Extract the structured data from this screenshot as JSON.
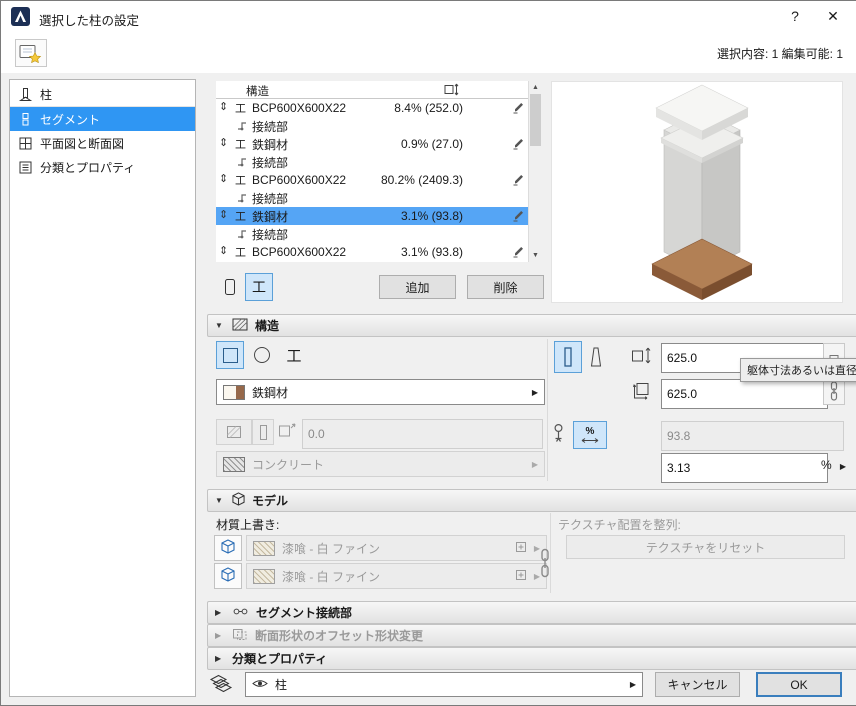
{
  "colors": {
    "selection_blue": "#2f96f3",
    "row_selection": "#55a5f5",
    "toggle_bg": "#cfe6fa",
    "toggle_border": "#5ba0d8",
    "material_brown": "#96684a",
    "base_brown": "#a87a50"
  },
  "icons": {
    "drag_handle": "⇕",
    "i_beam": "工",
    "chevron_right": "▶",
    "collapse_down": "▼",
    "collapse_right": "▶",
    "scroll_up": "▲",
    "scroll_down": "▼"
  },
  "window": {
    "title": "選択した柱の設定",
    "help_label": "?",
    "close_label": "✕",
    "selection_info": "選択内容: 1 編集可能: 1"
  },
  "sidebar": {
    "items": [
      {
        "label": "柱",
        "icon": "column-icon",
        "selected": false
      },
      {
        "label": "セグメント",
        "icon": "segment-icon",
        "selected": true
      },
      {
        "label": "平面図と断面図",
        "icon": "plan-section-icon",
        "selected": false
      },
      {
        "label": "分類とプロパティ",
        "icon": "properties-icon",
        "selected": false
      }
    ]
  },
  "segment_list": {
    "col_structure": "構造",
    "rows": [
      {
        "type": "segment",
        "name": "BCP600X600X22",
        "value": "8.4% (252.0)",
        "selected": false
      },
      {
        "type": "joint",
        "name": "接続部"
      },
      {
        "type": "segment",
        "name": "鉄鋼材",
        "value": "0.9% (27.0)",
        "selected": false
      },
      {
        "type": "joint",
        "name": "接続部"
      },
      {
        "type": "segment",
        "name": "BCP600X600X22",
        "value": "80.2% (2409.3)",
        "selected": false
      },
      {
        "type": "joint",
        "name": "接続部"
      },
      {
        "type": "segment",
        "name": "鉄鋼材",
        "value": "3.1% (93.8)",
        "selected": true
      },
      {
        "type": "joint",
        "name": "接続部"
      },
      {
        "type": "segment",
        "name": "BCP600X600X22",
        "value": "3.1% (93.8)",
        "selected": false
      }
    ],
    "add_label": "追加",
    "delete_label": "削除"
  },
  "structure_panel": {
    "title": "構造",
    "material_name": "鉄鋼材",
    "veneer_value": "0.0",
    "core_material_name": "コンクリート",
    "width_value": "625.0",
    "height_value": "625.0",
    "fixed_value": "93.8",
    "percent_value": "3.13",
    "percent_sign": "%",
    "tooltip": "躯体寸法あるいは直径"
  },
  "model_panel": {
    "title": "モデル",
    "override_label": "材質上書き:",
    "materials": [
      {
        "name": "漆喰 - 白 ファイン"
      },
      {
        "name": "漆喰 - 白 ファイン"
      }
    ],
    "texture_align_label": "テクスチャ配置を整列:",
    "texture_reset_label": "テクスチャをリセット"
  },
  "collapsed_panels": [
    {
      "label": "セグメント接続部",
      "icon": "joint-panel-icon",
      "disabled": false
    },
    {
      "label": "断面形状のオフセット形状変更",
      "icon": "offset-panel-icon",
      "disabled": true
    },
    {
      "label": "分類とプロパティ",
      "icon": "",
      "disabled": false
    }
  ],
  "footer": {
    "layer_name": "柱",
    "cancel_label": "キャンセル",
    "ok_label": "OK"
  }
}
